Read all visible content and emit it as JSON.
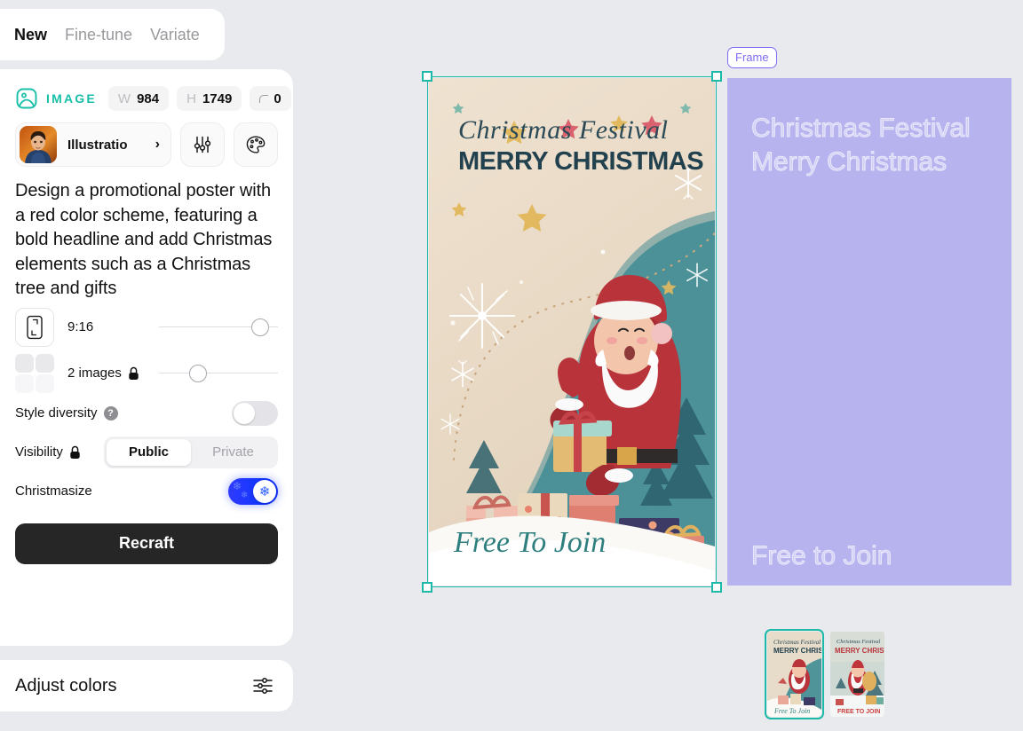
{
  "app": {
    "canvas_bg": "#e8eaed",
    "accent_teal": "#18bfa8",
    "accent_purple": "#7c6cf0",
    "accent_blue": "#1436ff"
  },
  "tabs": [
    {
      "label": "New",
      "active": true
    },
    {
      "label": "Fine-tune",
      "active": false
    },
    {
      "label": "Variate",
      "active": false
    }
  ],
  "image_row": {
    "icon": "image-avatar-icon",
    "label": "IMAGE",
    "width_key": "W",
    "width_value": "984",
    "height_key": "H",
    "height_value": "1749",
    "corner_icon": "corner-radius-icon",
    "corner_value": "0"
  },
  "style": {
    "name": "Illustratio",
    "chevron": "chevron-right-icon",
    "settings_icon": "sliders-icon",
    "palette_icon": "palette-icon"
  },
  "prompt": {
    "text": "Design a promotional poster with a red color scheme, featuring a bold headline and add Christmas elements such as a Christmas tree and gifts"
  },
  "controls": {
    "aspect_ratio": {
      "icon": "phone-portrait-icon",
      "label": "9:16",
      "slider_percent": 85
    },
    "image_count": {
      "icon": "grid-four-icon",
      "label": "2 images",
      "lock_icon": "lock-icon",
      "slider_percent": 33
    },
    "style_diversity": {
      "label": "Style diversity",
      "help_icon": "question-icon",
      "enabled": false
    },
    "visibility": {
      "label": "Visibility",
      "lock_icon": "lock-icon",
      "options": [
        "Public",
        "Private"
      ],
      "selected": "Public"
    },
    "christmasize": {
      "label": "Christmasize",
      "enabled": true,
      "icon": "snowflake-icon"
    },
    "recraft_button": "Recraft"
  },
  "adjust_colors": {
    "label": "Adjust colors",
    "icon": "adjust-sliders-icon"
  },
  "canvas": {
    "frame_badge": "Frame",
    "poster": {
      "script_title": "Christmas Festival",
      "main_title": "MERRY CHRISTMAS",
      "footer": "Free To Join"
    },
    "frame_panel": {
      "text_top": "Christmas Festival\nMerry Christmas",
      "text_bottom": "Free to Join"
    },
    "thumbnails": [
      {
        "name": "thumbnail-1",
        "selected": true,
        "script_title": "Christmas Festival",
        "main_title": "MERRY CHRISTMAS",
        "footer": "Free To Join"
      },
      {
        "name": "thumbnail-2",
        "selected": false,
        "script_title": "Christmas Festival",
        "main_title": "MERRY CHRISTMAS",
        "footer": "FREE TO JOIN"
      }
    ]
  }
}
